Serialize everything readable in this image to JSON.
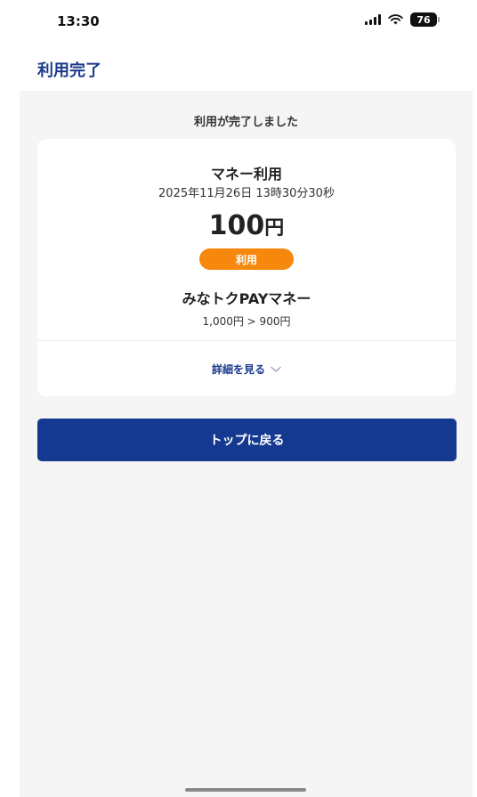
{
  "status_bar": {
    "time": "13:30",
    "battery": "76",
    "icons": [
      "signal-icon",
      "wifi-icon",
      "battery-icon"
    ]
  },
  "nav": {
    "title": "利用完了"
  },
  "main": {
    "completion_message": "利用が完了しました",
    "card": {
      "transaction_type": "マネー利用",
      "datetime": "2025年11月26日 13時30分30秒",
      "amount_value": "100",
      "amount_unit": "円",
      "badge": "利用",
      "wallet_name": "みなトクPAYマネー",
      "balance_change": "1,000円 > 900円",
      "details_link": "詳細を見る"
    },
    "back_to_top_label": "トップに戻る"
  },
  "colors": {
    "accent": "#153990",
    "title_blue": "#1b3a8c",
    "badge_orange": "#f7880e",
    "background": "#f5f5f5"
  }
}
